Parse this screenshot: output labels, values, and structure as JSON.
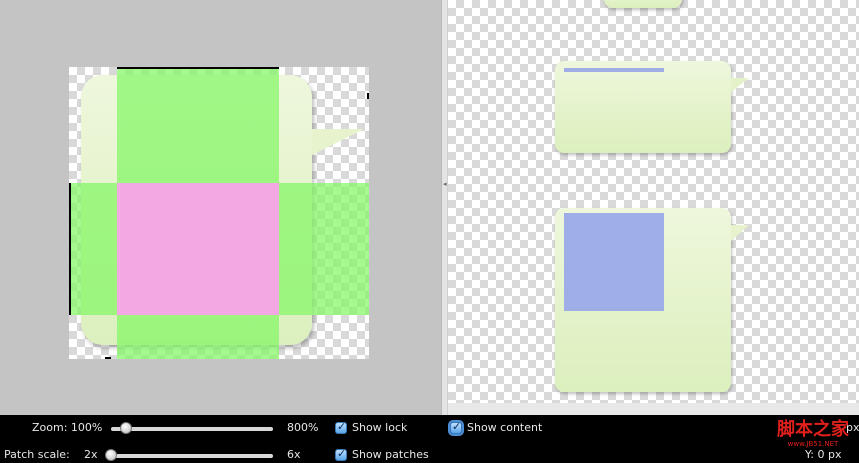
{
  "controls": {
    "zoom": {
      "label": "Zoom: 100%",
      "max_label": "800%",
      "value_percent": 100,
      "min_percent": 100,
      "max_percent": 800
    },
    "patch_scale": {
      "label": "Patch scale:",
      "min_label": "2x",
      "max_label": "6x",
      "value": 2,
      "min": 2,
      "max": 6
    },
    "show_lock": {
      "label": "Show lock",
      "checked": true
    },
    "show_patches": {
      "label": "Show patches",
      "checked": true
    },
    "show_content": {
      "label": "Show content",
      "checked": true
    },
    "coord_x_suffix": "px",
    "coord_y_readout": "Y: 0 px"
  },
  "watermark": {
    "text": "脚本之家",
    "url": "www.JB51.NET"
  },
  "colors": {
    "bubble_light": "#eef7dc",
    "bubble_dark": "#dcefbd",
    "stretch_patch": "#a3f88c",
    "fixed_patch": "#f3a8e4",
    "content_area": "#a0aee8",
    "control_bar": "#000000"
  }
}
